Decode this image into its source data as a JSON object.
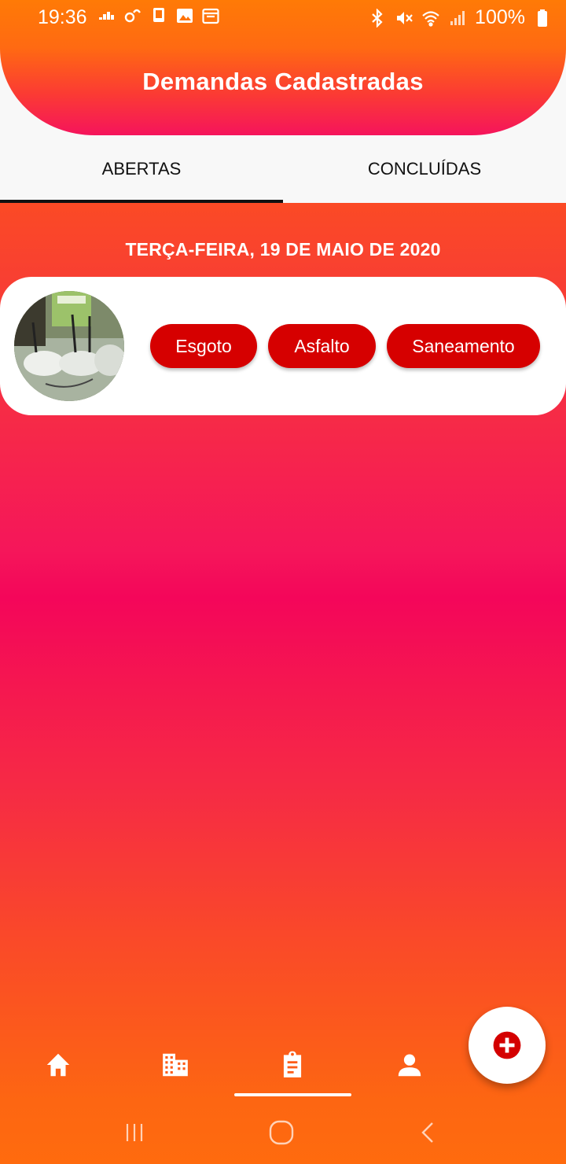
{
  "status_bar": {
    "time": "19:36",
    "battery_text": "100%",
    "left_icons": [
      "equalizer-icon",
      "chat-icon",
      "cast-icon",
      "image-icon",
      "calendar-icon"
    ],
    "right_icons": [
      "bluetooth-icon",
      "mute-icon",
      "wifi-icon",
      "signal-icon",
      "battery-icon"
    ]
  },
  "header": {
    "title": "Demandas Cadastradas"
  },
  "tabs": [
    {
      "label": "ABERTAS",
      "active": true
    },
    {
      "label": "CONCLUÍDAS",
      "active": false
    }
  ],
  "content": {
    "date_heading": "TERÇA-FEIRA, 19 DE MAIO DE 2020",
    "demands": [
      {
        "tags": [
          "Esgoto",
          "Asfalto",
          "Saneamento"
        ]
      }
    ]
  },
  "fab": {
    "icon": "add-circle-icon"
  },
  "bottom_nav": {
    "items": [
      {
        "icon": "home-icon"
      },
      {
        "icon": "building-icon"
      },
      {
        "icon": "clipboard-icon",
        "active": true
      },
      {
        "icon": "person-icon"
      }
    ]
  },
  "system_nav": [
    "recent-apps-icon",
    "home-circle-icon",
    "back-icon"
  ],
  "colors": {
    "accent_orange": "#ff6b0e",
    "accent_pink": "#f4065a",
    "chip_red": "#d60000",
    "header_bg": "#f8f8f8"
  }
}
